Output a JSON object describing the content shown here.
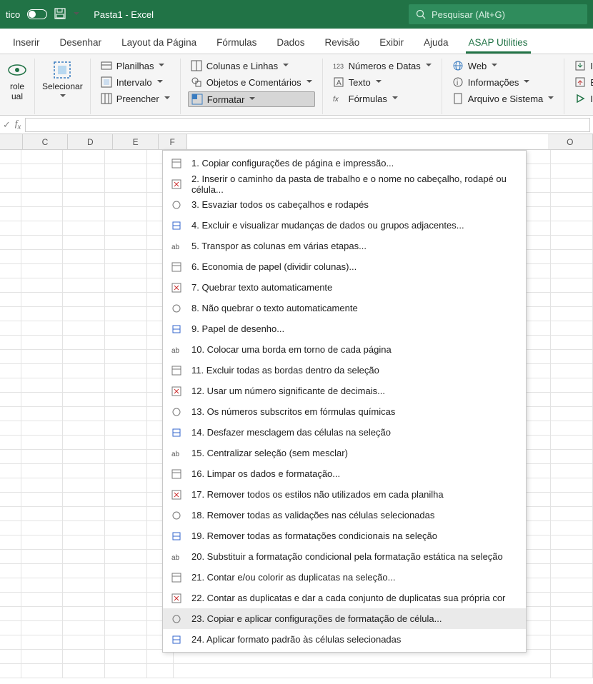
{
  "titlebar": {
    "autosave_partial": "tico",
    "workbook_title": "Pasta1 - Excel",
    "search_placeholder": "Pesquisar (Alt+G)"
  },
  "tabs": [
    {
      "label": "Inserir"
    },
    {
      "label": "Desenhar"
    },
    {
      "label": "Layout da Página"
    },
    {
      "label": "Fórmulas"
    },
    {
      "label": "Dados"
    },
    {
      "label": "Revisão"
    },
    {
      "label": "Exibir"
    },
    {
      "label": "Ajuda"
    },
    {
      "label": "ASAP Utilities",
      "active": true
    }
  ],
  "ribbon": {
    "big1": {
      "line1": "role",
      "line2": "ual"
    },
    "big2": {
      "label": "Selecionar"
    },
    "col1": {
      "a": "Planilhas",
      "b": "Intervalo",
      "c": "Preencher"
    },
    "col2": {
      "a": "Colunas e Linhas",
      "b": "Objetos e Comentários",
      "c": "Formatar"
    },
    "col3": {
      "a": "Números e Datas",
      "b": "Texto",
      "c": "Fórmulas"
    },
    "col4": {
      "a": "Web",
      "b": "Informações",
      "c": "Arquivo e Sistema"
    },
    "col5": {
      "a": "Importar",
      "b": "Exportar",
      "c": "Iniciar"
    }
  },
  "columns": [
    "",
    "C",
    "D",
    "E",
    "F",
    "",
    "",
    "",
    "",
    "",
    "",
    "O"
  ],
  "menu": [
    "1. Copiar configurações de página e impressão...",
    "2. Inserir o caminho da pasta de trabalho e o nome no cabeçalho, rodapé ou célula...",
    "3. Esvaziar todos os cabeçalhos e rodapés",
    "4. Excluir e visualizar mudanças de dados ou grupos adjacentes...",
    "5. Transpor as colunas em várias etapas...",
    "6. Economia de papel (dividir colunas)...",
    "7. Quebrar texto automaticamente",
    "8. Não quebrar o texto automaticamente",
    "9. Papel de desenho...",
    "10. Colocar uma borda em torno de cada página",
    "11. Excluir todas as bordas dentro da seleção",
    "12. Usar um número significante de decimais...",
    "13. Os números subscritos em fórmulas químicas",
    "14. Desfazer mesclagem das células na seleção",
    "15. Centralizar seleção (sem mesclar)",
    "16. Limpar os dados e formatação...",
    "17. Remover todos os estilos não utilizados em cada planilha",
    "18. Remover todas as validações nas células selecionadas",
    "19. Remover todas as formatações condicionais na seleção",
    "20. Substituir a formatação condicional pela formatação estática na seleção",
    "21. Contar e/ou colorir as duplicatas na seleção...",
    "22. Contar as duplicatas e dar a cada conjunto de duplicatas sua própria cor",
    "23. Copiar e aplicar configurações de formatação de célula...",
    "24. Aplicar formato padrão às células selecionadas"
  ],
  "menu_hover_index": 22
}
